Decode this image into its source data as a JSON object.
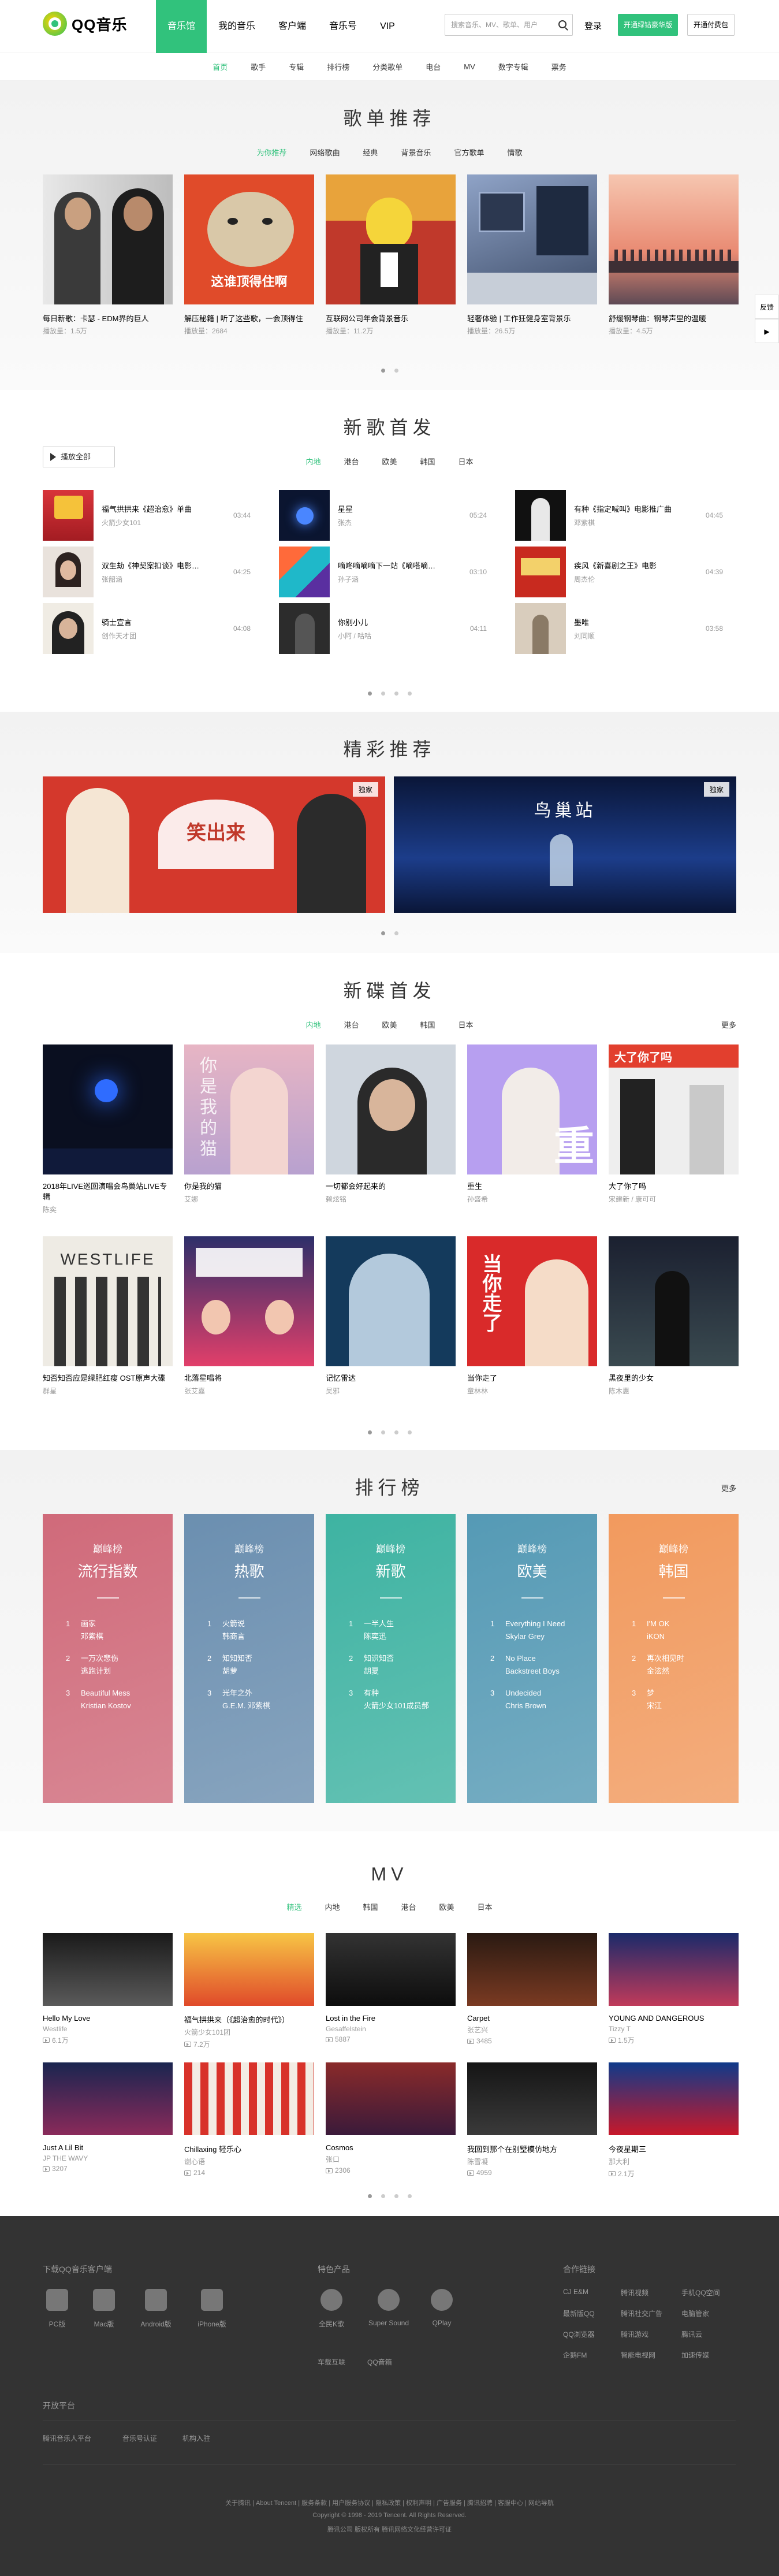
{
  "header": {
    "logo_text": "QQ音乐",
    "nav": [
      "音乐馆",
      "我的音乐",
      "客户端",
      "音乐号",
      "VIP"
    ],
    "search_placeholder": "搜索音乐、MV、歌单、用户",
    "login": "登录",
    "btn_green": "开通绿钻豪华版",
    "btn_white": "开通付费包"
  },
  "subnav": [
    "首页",
    "歌手",
    "专辑",
    "排行榜",
    "分类歌单",
    "电台",
    "MV",
    "数字专辑",
    "票务"
  ],
  "side_tools": {
    "feedback": "反馈"
  },
  "playlist": {
    "title": "歌单推荐",
    "tabs": [
      "为你推荐",
      "网络歌曲",
      "经典",
      "背景音乐",
      "官方歌单",
      "情歌"
    ],
    "items": [
      {
        "title": "每日新歌：卡瑟 - EDM界的巨人",
        "count": "播放量：1.5万"
      },
      {
        "title": "解压秘籍 | 听了这些歌，一会顶得住",
        "count": "播放量：2684"
      },
      {
        "title": "互联网公司年会背景音乐",
        "count": "播放量：11.2万"
      },
      {
        "title": "轻奢体验 | 工作狂健身室背景乐",
        "count": "播放量：26.5万"
      },
      {
        "title": "舒缓钢琴曲：钢琴声里的温暖",
        "count": "播放量：4.5万"
      }
    ],
    "cat_text": "这谁顶得住啊"
  },
  "newsongs": {
    "title": "新歌首发",
    "play_all": "播放全部",
    "tabs": [
      "内地",
      "港台",
      "欧美",
      "韩国",
      "日本"
    ],
    "songs": [
      {
        "name": "福气拱拱来《超治愈》单曲",
        "artist": "火箭少女101",
        "dur": "03:44"
      },
      {
        "name": "双生劫《神契案扣谈》电影主题曲",
        "artist": "张韶涵",
        "dur": "04:25"
      },
      {
        "name": "骑士宣言",
        "artist": "创作天才团",
        "dur": "04:08"
      },
      {
        "name": "星星",
        "artist": "张杰",
        "dur": "05:24"
      },
      {
        "name": "嘀咚嘀嘀嘀下一站《嘀嗒嘀嗒》",
        "artist": "孙子涵",
        "dur": "03:10"
      },
      {
        "name": "你别小儿",
        "artist": "小阿 / 咕咕",
        "dur": "04:11"
      },
      {
        "name": "有种《指定喊叫》电影推广曲",
        "artist": "邓紫棋",
        "dur": "04:45"
      },
      {
        "name": "疾风《新喜剧之王》电影",
        "artist": "周杰伦",
        "dur": "04:39"
      },
      {
        "name": "墨唯",
        "artist": "刘同顺",
        "dur": "03:58"
      }
    ]
  },
  "featured": {
    "title": "精彩推荐",
    "badge1": "独家",
    "badge2": "独家",
    "banner2_title": "鸟巢站",
    "banner1_text": "笑出来"
  },
  "albums": {
    "title": "新碟首发",
    "tabs": [
      "内地",
      "港台",
      "欧美",
      "韩国",
      "日本"
    ],
    "more": "更多",
    "items": [
      {
        "title": "2018年LIVE巡回演唱会鸟巢站LIVE专辑",
        "artist": "陈奕"
      },
      {
        "title": "你是我的猫",
        "artist": "艾娜"
      },
      {
        "title": "一切都会好起来的",
        "artist": "赖炫铭"
      },
      {
        "title": "重生",
        "artist": "孙盛希"
      },
      {
        "title": "大了你了吗",
        "artist": "宋建新 / 康可可"
      },
      {
        "title": "知否知否应是绿肥红瘦 OST原声大碟",
        "artist": "群星"
      },
      {
        "title": "北落星唱将",
        "artist": "张艾嘉"
      },
      {
        "title": "记忆雷达",
        "artist": "吴邪"
      },
      {
        "title": "当你走了",
        "artist": "童林林"
      },
      {
        "title": "黑夜里的少女",
        "artist": "陈木惠"
      }
    ],
    "cover_text": [
      "你是我的猫",
      "重生",
      "大了你了吗",
      "当你走了"
    ]
  },
  "charts": {
    "title": "排行榜",
    "more": "更多",
    "brand": "巅峰榜",
    "lists": [
      {
        "name": "流行指数",
        "songs": [
          [
            "1",
            "画家"
          ],
          [
            "",
            "邓紫棋"
          ],
          [
            "2",
            "一万次悲伤"
          ],
          [
            "",
            "逃跑计划"
          ],
          [
            "3",
            "Beautiful Mess"
          ],
          [
            "",
            "Kristian Kostov"
          ]
        ],
        "color": "#d06a7a"
      },
      {
        "name": "热歌",
        "songs": [
          [
            "1",
            "火箭说"
          ],
          [
            "",
            "韩商言"
          ],
          [
            "2",
            "知知知否"
          ],
          [
            "",
            "胡萝"
          ],
          [
            "3",
            "光年之外"
          ],
          [
            "",
            "G.E.M. 邓紫棋"
          ]
        ],
        "color": "#6b8fb0"
      },
      {
        "name": "新歌",
        "songs": [
          [
            "1",
            "一半人生"
          ],
          [
            "",
            "陈奕迅"
          ],
          [
            "2",
            "知识知否"
          ],
          [
            "",
            "胡夏"
          ],
          [
            "3",
            "有种"
          ],
          [
            "",
            "火箭少女101成员郝"
          ]
        ],
        "color": "#3eb3a2"
      },
      {
        "name": "欧美",
        "songs": [
          [
            "1",
            "Everything I Need"
          ],
          [
            "",
            "Skylar Grey"
          ],
          [
            "2",
            "No Place"
          ],
          [
            "",
            "Backstreet Boys"
          ],
          [
            "3",
            "Undecided"
          ],
          [
            "",
            "Chris Brown"
          ]
        ],
        "color": "#559ab5"
      },
      {
        "name": "韩国",
        "songs": [
          [
            "1",
            "I'M OK"
          ],
          [
            "",
            "iKON"
          ],
          [
            "2",
            "再次相见时"
          ],
          [
            "",
            "金泫然"
          ],
          [
            "3",
            "梦"
          ],
          [
            "",
            "宋江"
          ]
        ],
        "color": "#f29a5e"
      }
    ]
  },
  "mv": {
    "title": "MV",
    "tabs": [
      "精选",
      "内地",
      "韩国",
      "港台",
      "欧美",
      "日本"
    ],
    "items": [
      {
        "title": "Hello My Love",
        "artist": "Westlife",
        "plays": "6.1万"
      },
      {
        "title": "福气拱拱来（《超治愈的时代》）",
        "artist": "火箭少女101团",
        "plays": "7.2万"
      },
      {
        "title": "Lost in the Fire",
        "artist": "Gesaffelstein",
        "plays": "5887"
      },
      {
        "title": "Carpet",
        "artist": "张艺兴",
        "plays": "3485"
      },
      {
        "title": "YOUNG AND DANGEROUS",
        "artist": "Tizzy T",
        "plays": "1.5万"
      },
      {
        "title": "Just A Lil Bit",
        "artist": "JP THE WAVY",
        "plays": "3207"
      },
      {
        "title": "Chillaxing 轻乐心",
        "artist": "谢心语",
        "plays": "214"
      },
      {
        "title": "Cosmos",
        "artist": "张口",
        "plays": "2306"
      },
      {
        "title": "我回到那个在别墅模仿地方",
        "artist": "陈雪凝",
        "plays": "4959"
      },
      {
        "title": "今夜星期三",
        "artist": "那大利",
        "plays": "2.1万"
      }
    ],
    "banner_text": "WESTLIFE"
  },
  "footer": {
    "download_title": "下载QQ音乐客户端",
    "os": [
      "PC版",
      "Mac版",
      "Android版",
      "iPhone版"
    ],
    "products_title": "特色产品",
    "products": [
      "全民K歌",
      "Super Sound",
      "QPlay",
      "车载互联",
      "QQ音箱"
    ],
    "links_title": "合作链接",
    "links": [
      "CJ E&M",
      "腾讯视频",
      "手机QQ空间",
      "最新版QQ",
      "腾讯社交广告",
      "电脑管家",
      "QQ浏览器",
      "腾讯游戏",
      "腾讯云",
      "企鹅FM",
      "智能电视网",
      "加速传媒"
    ],
    "platform_title": "开放平台",
    "platform": [
      "腾讯音乐人平台",
      "音乐号认证",
      "机构入驻"
    ],
    "bottom1": "关于腾讯 | About Tencent | 服务条款 | 用户服务协议 | 隐私政策 | 权利声明 | 广告服务 | 腾讯招聘 | 客服中心 | 网站导航",
    "bottom2": "Copyright © 1998 - 2019 Tencent. All Rights Reserved.",
    "bottom3": "腾讯公司 版权所有 腾讯网络文化经营许可证"
  }
}
